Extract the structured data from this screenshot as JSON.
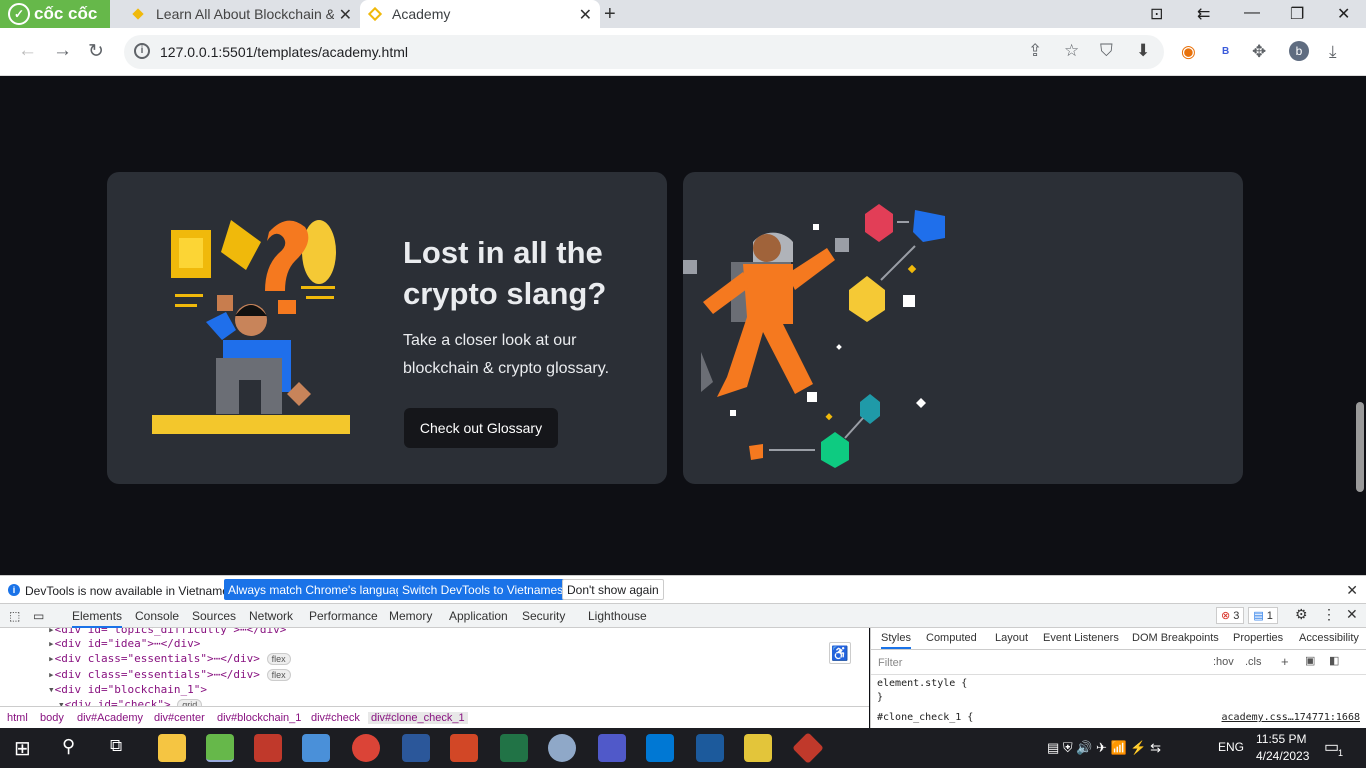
{
  "browser": {
    "logo_text": "cốc cốc",
    "tabs": [
      {
        "title": "Learn All About Blockchain &",
        "active": false
      },
      {
        "title": "Academy",
        "active": true
      }
    ],
    "url": "127.0.0.1:5501/templates/academy.html",
    "profile_letter": "b",
    "ext_letter": "B"
  },
  "card": {
    "title": "Lost in all the crypto slang?",
    "description": "Take a closer look at our blockchain & crypto glossary.",
    "button": "Check out Glossary"
  },
  "devtools": {
    "notice": {
      "message": "DevTools is now available in Vietnamese!",
      "btn_match": "Always match Chrome's language",
      "btn_switch": "Switch DevTools to Vietnamese",
      "btn_dismiss": "Don't show again"
    },
    "tabs": [
      "Elements",
      "Console",
      "Sources",
      "Network",
      "Performance",
      "Memory",
      "Application",
      "Security",
      "Lighthouse"
    ],
    "error_count": "3",
    "message_count": "1",
    "dom_lines": [
      "<div id=\"topics_difficulty\">⋯</div>",
      "<div id=\"idea\">⋯</div>",
      "<div class=\"essentials\">⋯</div>",
      "<div class=\"essentials\">⋯</div>",
      "<div id=\"blockchain_1\">",
      "<div id=\"check\">"
    ],
    "pill_flex": "flex",
    "pill_grid": "grid",
    "breadcrumb": [
      "html",
      "body",
      "div#Academy",
      "div#center",
      "div#blockchain_1",
      "div#check",
      "div#clone_check_1"
    ],
    "styles_tabs": [
      "Styles",
      "Computed",
      "Layout",
      "Event Listeners",
      "DOM Breakpoints",
      "Properties",
      "Accessibility"
    ],
    "filter_placeholder": "Filter",
    "hov": ":hov",
    "cls": ".cls",
    "css_lines": [
      "element.style {",
      "}",
      "#clone_check_1 {"
    ],
    "css_source": "academy.css…174771:1668"
  },
  "taskbar": {
    "language": "ENG",
    "time": "11:55 PM",
    "date": "4/24/2023",
    "notification_count": "1"
  }
}
